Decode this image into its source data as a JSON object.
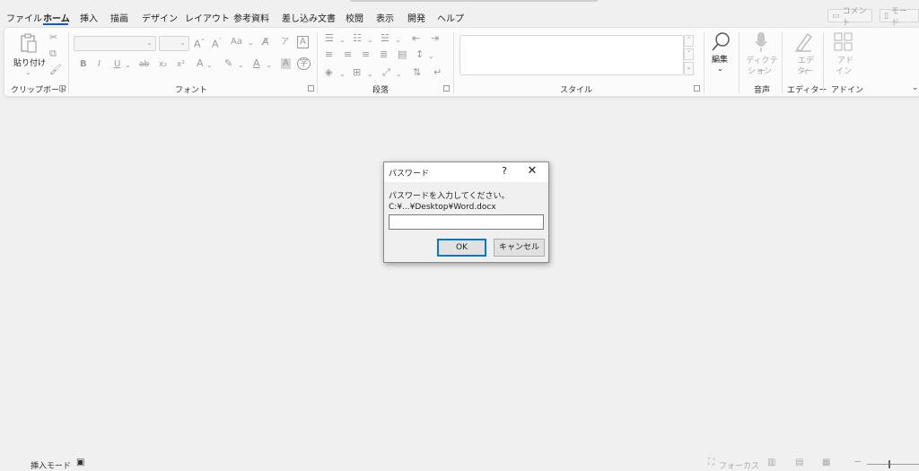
{
  "menu": {
    "tabs": [
      {
        "label": "ファイル"
      },
      {
        "label": "ホーム",
        "active": true
      },
      {
        "label": "挿入"
      },
      {
        "label": "描画"
      },
      {
        "label": "デザイン"
      },
      {
        "label": "レイアウト"
      },
      {
        "label": "参考資料"
      },
      {
        "label": "差し込み文書"
      },
      {
        "label": "校閲"
      },
      {
        "label": "表示"
      },
      {
        "label": "開発"
      },
      {
        "label": "ヘルプ"
      }
    ],
    "comment_button": "コメント",
    "mode_button": "モード"
  },
  "ribbon": {
    "clipboard": {
      "paste_label": "貼り付け",
      "group_label": "クリップボード"
    },
    "font": {
      "group_label": "フォント",
      "font_case": "Aa",
      "bold": "B",
      "italic": "I",
      "underline": "U",
      "strike": "ab",
      "subscript": "x₂",
      "superscript": "x²"
    },
    "paragraph": {
      "group_label": "段落"
    },
    "styles": {
      "group_label": "スタイル"
    },
    "editing": {
      "label": "編集"
    },
    "voice": {
      "dictate_label_1": "ディクテー",
      "dictate_label_2": "ション",
      "group_label": "音声"
    },
    "editor": {
      "label_1": "エディ",
      "label_2": "ター",
      "group_label": "エディター"
    },
    "addins": {
      "label_1": "アド",
      "label_2": "イン",
      "group_label": "アドイン"
    }
  },
  "dialog": {
    "title": "パスワード",
    "help": "?",
    "close": "✕",
    "message": "パスワードを入力してください。",
    "path": "C:¥...¥Desktop¥Word.docx",
    "password_value": "",
    "ok_label": "OK",
    "cancel_label": "キャンセル"
  },
  "status": {
    "insert_mode": "挿入モード",
    "focus": "フォーカス"
  },
  "colors": {
    "accent": "#185abd",
    "dialog_focus": "#0078d7"
  }
}
